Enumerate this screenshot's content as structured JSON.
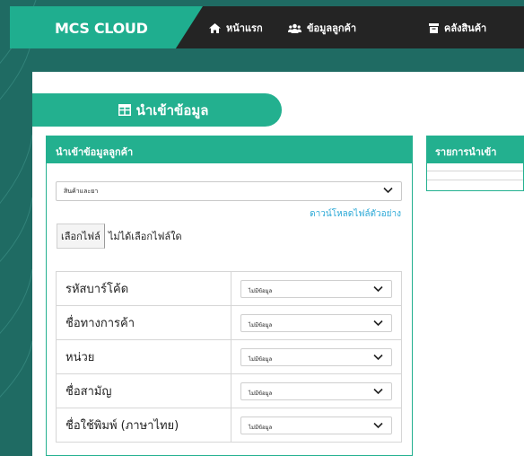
{
  "brand": {
    "name": "MCS CLOUD"
  },
  "nav": {
    "items": [
      {
        "label": "หน้าแรก",
        "icon": "home-icon"
      },
      {
        "label": "ข้อมูลลูกค้า",
        "icon": "users-icon"
      },
      {
        "label": "คลังสินค้า",
        "icon": "warehouse-icon"
      }
    ]
  },
  "banner": {
    "title": "นำเข้าข้อมูล",
    "icon": "table-icon"
  },
  "import_card": {
    "title": "นำเข้าข้อมูลลูกค้า",
    "category_select": {
      "value": "สินค้าและยา"
    },
    "download_link": "ดาวน์โหลดไฟล์ตัวอย่าง",
    "file_button": "เลือกไฟล์",
    "file_status": "ไม่ได้เลือกไฟล์ใด",
    "field_map": [
      {
        "label": "รหัสบาร์โค้ด",
        "value": "ไม่มีข้อมูล"
      },
      {
        "label": "ชื่อทางการค้า",
        "value": "ไม่มีข้อมูล"
      },
      {
        "label": "หน่วย",
        "value": "ไม่มีข้อมูล"
      },
      {
        "label": "ชื่อสามัญ",
        "value": "ไม่มีข้อมูล"
      },
      {
        "label": "ชื่อใช้พิมพ์ (ภาษาไทย)",
        "value": "ไม่มีข้อมูล"
      }
    ]
  },
  "list_card": {
    "title": "รายการนำเข้า"
  },
  "colors": {
    "accent": "#23b08f",
    "topbar": "#242424",
    "background": "#1f6b63",
    "link": "#2aa8d6"
  }
}
